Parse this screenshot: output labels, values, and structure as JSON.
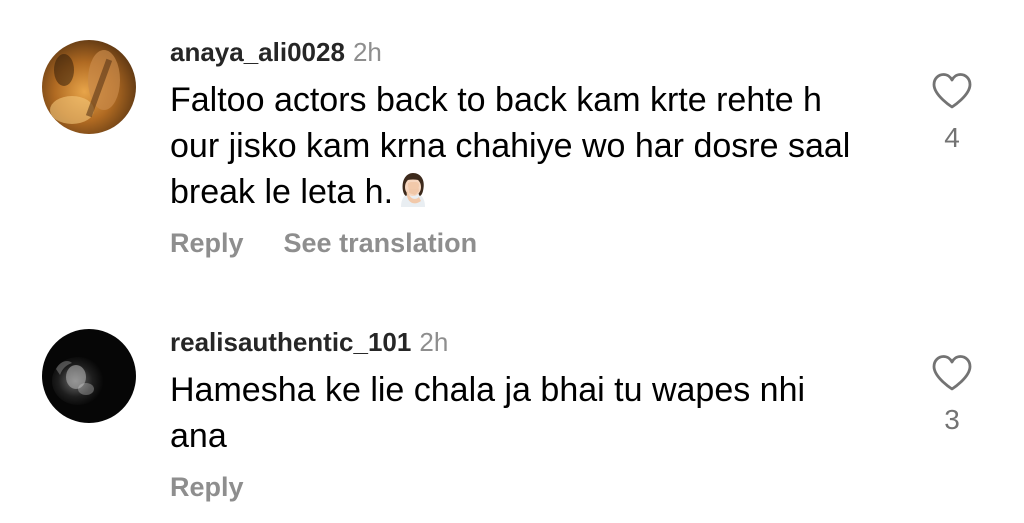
{
  "comments": [
    {
      "username": "anaya_ali0028",
      "time": "2h",
      "text": "Faltoo actors back to back kam krte rehte h our jisko kam krna chahiye wo har dosre saal break le leta h.",
      "emoji": "woman-facepalming-icon",
      "likes": "4",
      "reply_label": "Reply",
      "translate_label": "See translation"
    },
    {
      "username": "realisauthentic_101",
      "time": "2h",
      "text": "Hamesha ke lie chala ja bhai tu wapes nhi ana",
      "likes": "3",
      "reply_label": "Reply"
    }
  ],
  "colors": {
    "username": "#262626",
    "secondary": "#8e8e8e",
    "text": "#000000"
  }
}
